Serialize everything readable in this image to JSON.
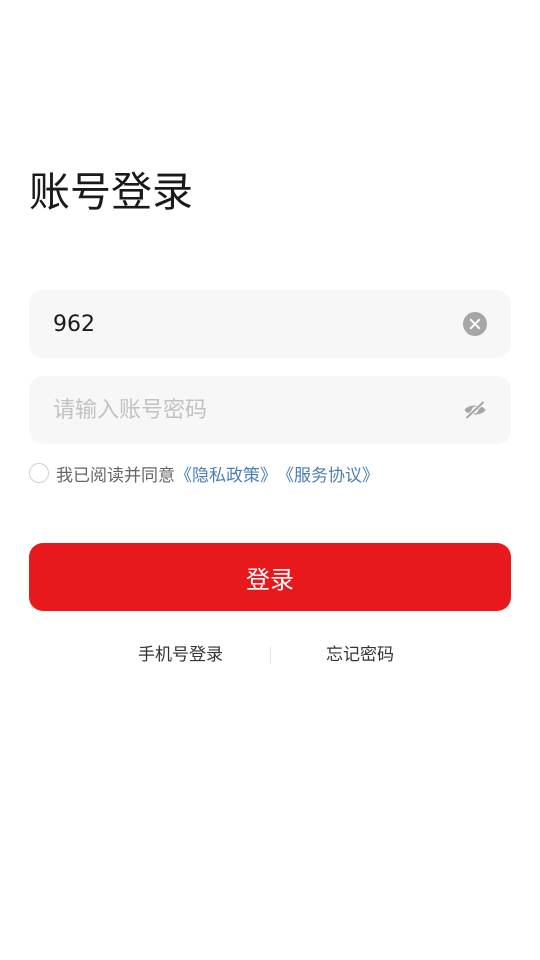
{
  "page": {
    "title": "账号登录"
  },
  "account_field": {
    "value": "962",
    "clear_icon": "clear-icon"
  },
  "password_field": {
    "value": "",
    "placeholder": "请输入账号密码",
    "toggle_icon": "eye-off-icon"
  },
  "agreement": {
    "checked": false,
    "prefix": "我已阅读并同意",
    "privacy_link": "《隐私政策》",
    "service_link": "《服务协议》"
  },
  "login_button": {
    "label": "登录"
  },
  "footer": {
    "phone_login": "手机号登录",
    "forgot_password": "忘记密码"
  },
  "colors": {
    "primary": "#e8191c",
    "link": "#4a7fb5",
    "field_bg": "#f7f7f7",
    "placeholder": "#c2c2c2"
  }
}
